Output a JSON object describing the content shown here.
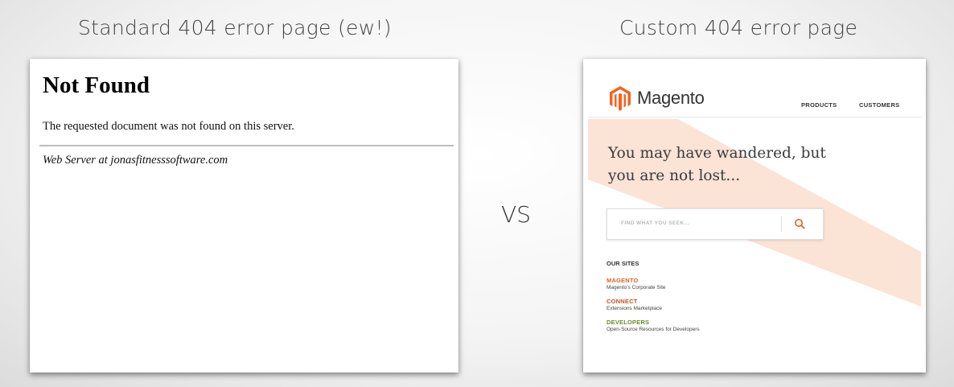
{
  "headings": {
    "left": "Standard 404 error page (ew!)",
    "right": "Custom 404 error page",
    "vs": "VS"
  },
  "standard_page": {
    "title": "Not Found",
    "message": "The requested document was not found on this server.",
    "server_line": "Web Server at jonasfitnesssoftware.com"
  },
  "custom_page": {
    "logo_text": "Magento",
    "nav": [
      "PRODUCTS",
      "CUSTOMERS"
    ],
    "hero_text": "You may have wandered, but you are not lost...",
    "search": {
      "placeholder": "FIND WHAT YOU SEEK...",
      "icon": "search-icon"
    },
    "sites_title": "OUR SITES",
    "sites": [
      {
        "name": "MAGENTO",
        "desc": "Magento's Corporate Site",
        "color": "#e0612a"
      },
      {
        "name": "CONNECT",
        "desc": "Extensions Marketplace",
        "color": "#c8511f"
      },
      {
        "name": "DEVELOPERS",
        "desc": "Open-Source Resources for Developers",
        "color": "#6e8a2a"
      }
    ],
    "colors": {
      "brand": "#f26322",
      "stripe": "#fbe3d6"
    }
  }
}
